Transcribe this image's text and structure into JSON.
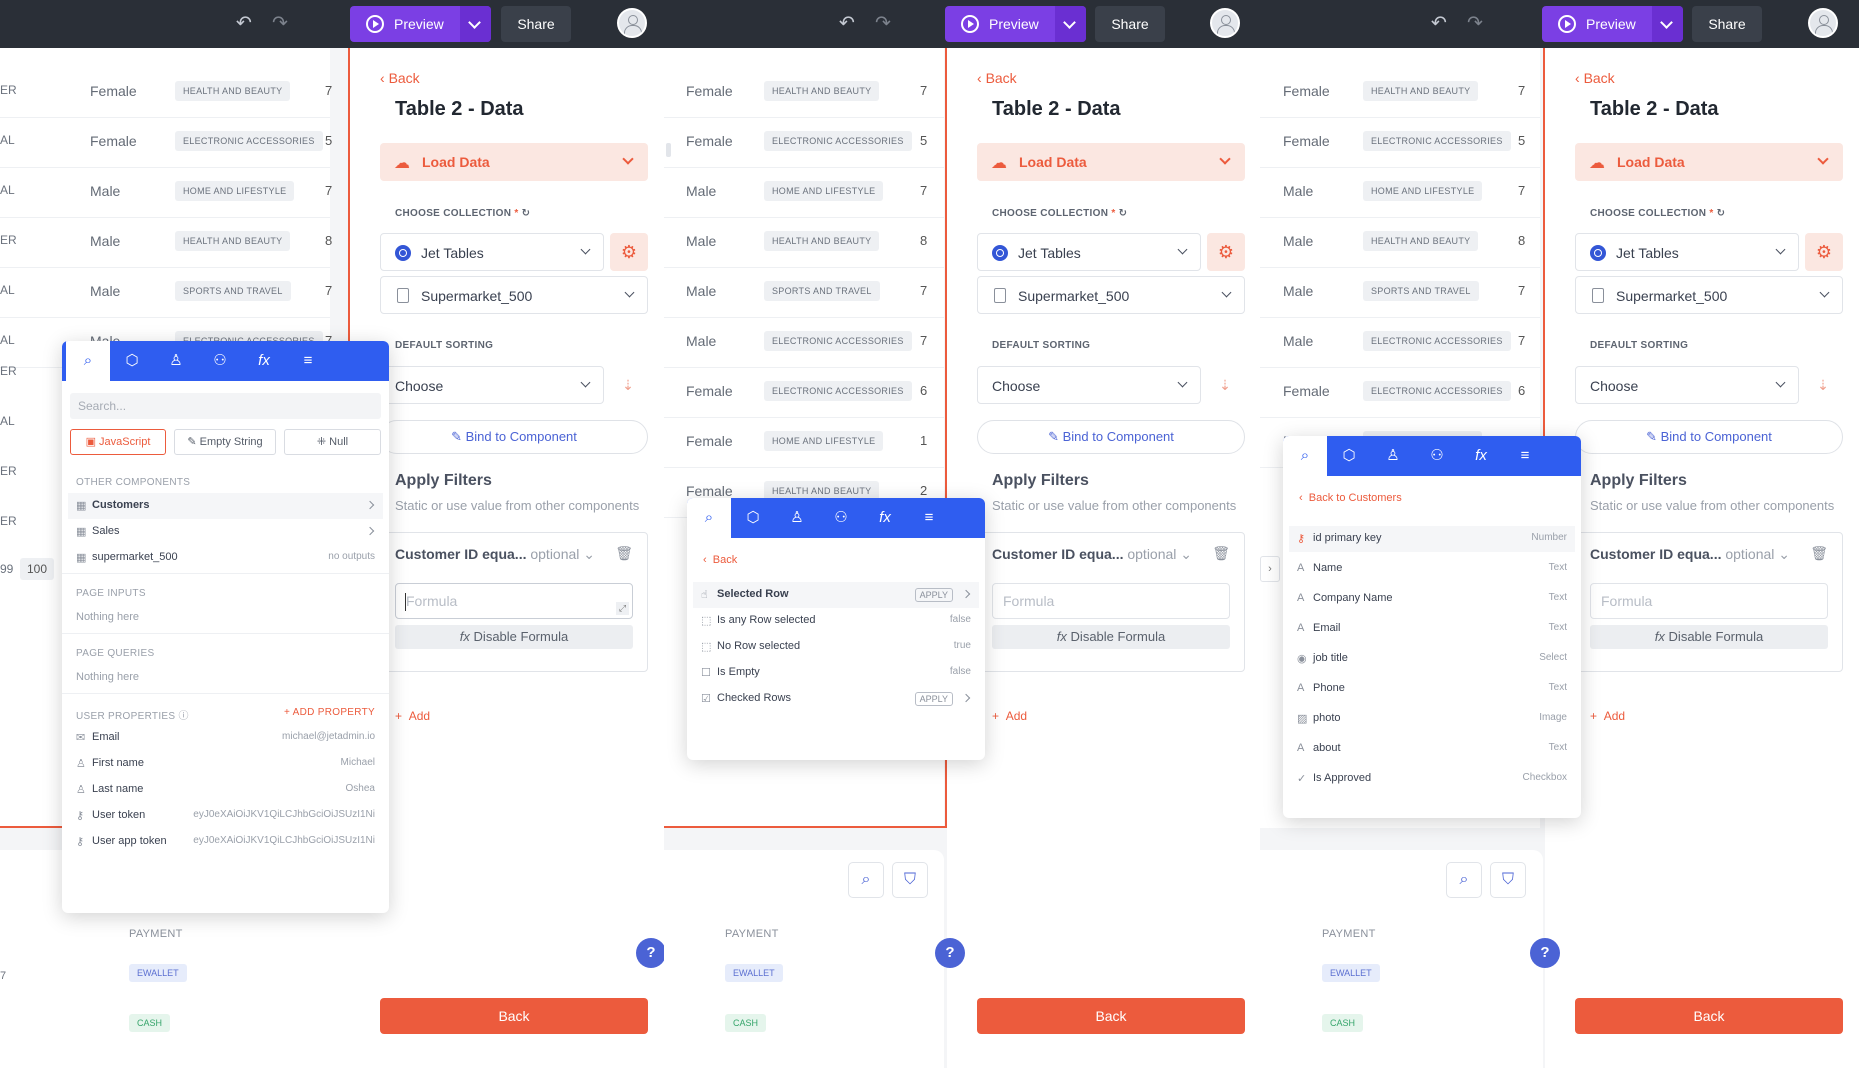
{
  "colors": {
    "accent": "#ec5b3d",
    "brand": "#7b3fe4",
    "popup": "#2f5df0",
    "topbar": "#2a2f37"
  },
  "topbar": {
    "preview": "Preview",
    "share": "Share",
    "icons": [
      "undo-icon",
      "redo-icon",
      "play-icon",
      "chevron-down-icon",
      "avatar-icon"
    ]
  },
  "table": {
    "rows": [
      {
        "gender": "Female",
        "category": "HEALTH AND BEAUTY"
      },
      {
        "gender": "Female",
        "category": "ELECTRONIC ACCESSORIES"
      },
      {
        "gender": "Male",
        "category": "HOME AND LIFESTYLE"
      },
      {
        "gender": "Male",
        "category": "HEALTH AND BEAUTY"
      },
      {
        "gender": "Male",
        "category": "SPORTS AND TRAVEL"
      },
      {
        "gender": "Male",
        "category": "ELECTRONIC ACCESSORIES"
      },
      {
        "gender": "Female",
        "category": "ELECTRONIC ACCESSORIES"
      },
      {
        "gender": "Female",
        "category": "HOME AND LIFESTYLE"
      },
      {
        "gender": "Female",
        "category": "HEALTH AND BEAUTY"
      }
    ],
    "left_frag": [
      "ER",
      "AL",
      "AL",
      "ER",
      "AL",
      "AL",
      "ER",
      "AL",
      "ER",
      "ER"
    ],
    "trail": [
      "7",
      "5",
      "7",
      "8",
      "7",
      "7",
      "6",
      "1",
      "2"
    ],
    "p1_last": {
      "a": "99",
      "b": "100"
    },
    "p1_trail": [
      "7",
      "5",
      "7",
      "8",
      "7",
      "7"
    ],
    "payment_header": "PAYMENT",
    "payments": [
      "EWALLET",
      "CASH"
    ],
    "p1_pay_left": "7"
  },
  "sidebar": {
    "back": "Back",
    "title": "Table 2 - Data",
    "load_data": "Load Data",
    "choose_collection": "CHOOSE COLLECTION",
    "required": "*",
    "jet_tables": "Jet Tables",
    "supermarket": "Supermarket_500",
    "default_sorting": "DEFAULT SORTING",
    "choose": "Choose",
    "bind": "Bind to Component",
    "apply_filters": "Apply Filters",
    "apply_filters_sub": "Static or use value from other components",
    "filter_label": "Customer ID equa...",
    "optional": "optional",
    "formula_placeholder": "Formula",
    "disable_formula": "Disable Formula",
    "add": "Add",
    "back_button": "Back"
  },
  "popup1": {
    "search_placeholder": "Search...",
    "chips": [
      "JavaScript",
      "Empty String",
      "Null"
    ],
    "other_components": "OTHER COMPONENTS",
    "components": [
      {
        "label": "Customers",
        "right": ""
      },
      {
        "label": "Sales",
        "right": ""
      },
      {
        "label": "supermarket_500",
        "right": "no outputs"
      }
    ],
    "page_inputs": "PAGE INPUTS",
    "page_inputs_empty": "Nothing here",
    "page_queries": "PAGE QUERIES",
    "page_queries_empty": "Nothing here",
    "user_properties": "USER PROPERTIES",
    "add_property": "+ ADD PROPERTY",
    "props": [
      {
        "label": "Email",
        "value": "michael@jetadmin.io"
      },
      {
        "label": "First name",
        "value": "Michael"
      },
      {
        "label": "Last name",
        "value": "Oshea"
      },
      {
        "label": "User token",
        "value": "eyJ0eXAiOiJKV1QiLCJhbGciOiJSUzI1Ni"
      },
      {
        "label": "User app token",
        "value": "eyJ0eXAiOiJKV1QiLCJhbGciOiJSUzI1Ni"
      }
    ]
  },
  "popup2": {
    "back": "Back",
    "apply": "APPLY",
    "items": [
      {
        "label": "Selected Row",
        "right": ""
      },
      {
        "label": "Is any Row selected",
        "right": "false"
      },
      {
        "label": "No Row selected",
        "right": "true"
      },
      {
        "label": "Is Empty",
        "right": "false"
      },
      {
        "label": "Checked Rows",
        "right": ""
      }
    ]
  },
  "popup3": {
    "back": "Back to Customers",
    "fields": [
      {
        "label": "id primary key",
        "type": "Number"
      },
      {
        "label": "Name",
        "type": "Text"
      },
      {
        "label": "Company Name",
        "type": "Text"
      },
      {
        "label": "Email",
        "type": "Text"
      },
      {
        "label": "job title",
        "type": "Select"
      },
      {
        "label": "Phone",
        "type": "Text"
      },
      {
        "label": "photo",
        "type": "Image"
      },
      {
        "label": "about",
        "type": "Text"
      },
      {
        "label": "Is Approved",
        "type": "Checkbox"
      }
    ]
  }
}
